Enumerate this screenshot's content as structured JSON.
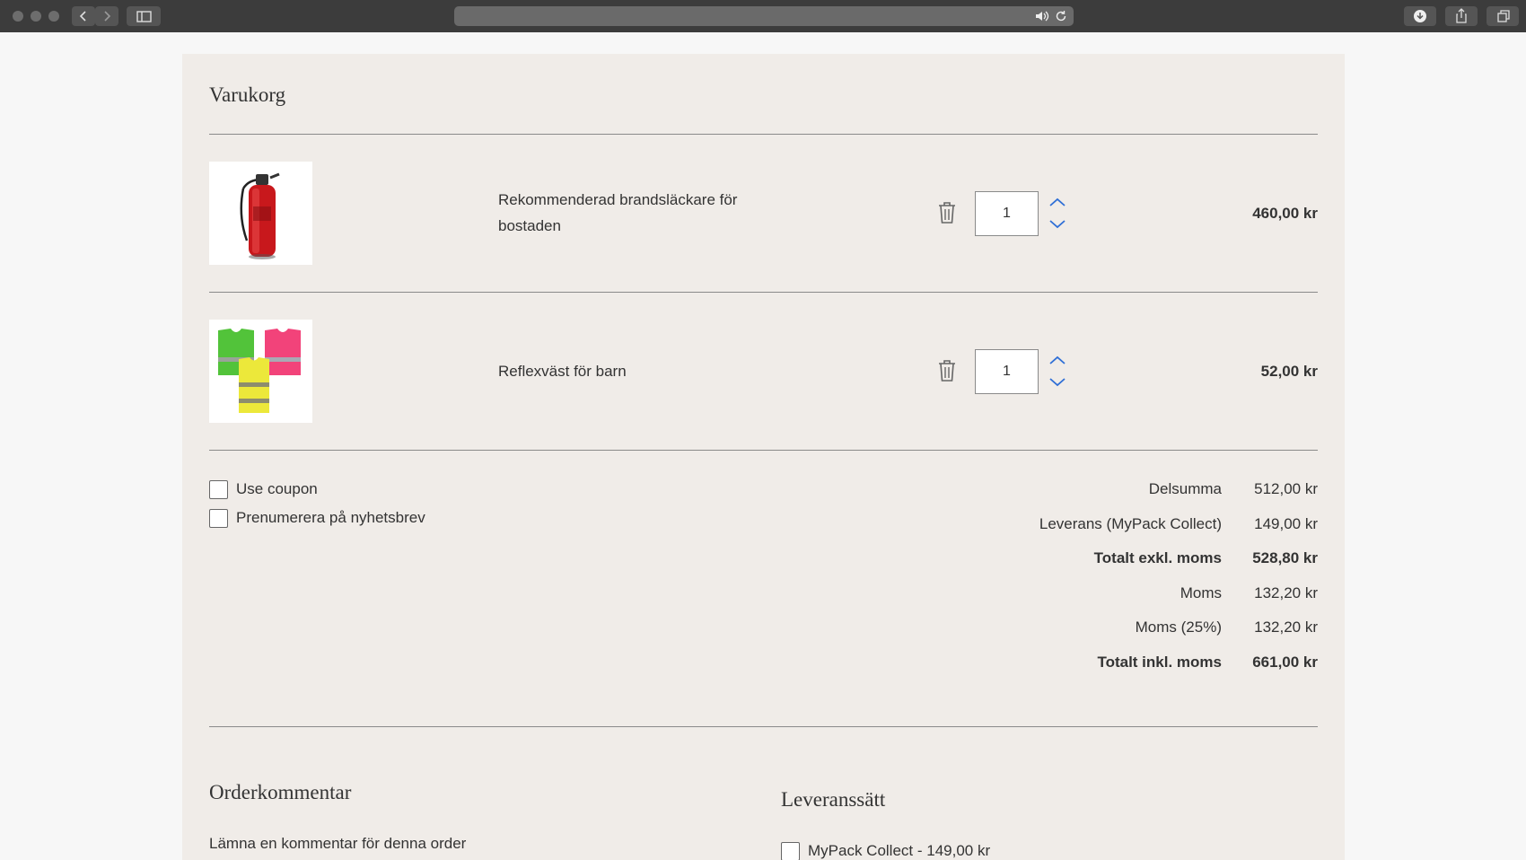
{
  "cart": {
    "title": "Varukorg",
    "items": [
      {
        "name": "Rekommenderad brandsläckare för bostaden",
        "quantity": "1",
        "price": "460,00 kr",
        "image": "fire-extinguisher"
      },
      {
        "name": "Reflexväst för barn",
        "quantity": "1",
        "price": "52,00 kr",
        "image": "reflective-vests"
      }
    ],
    "options": [
      {
        "label": "Use coupon",
        "checked": false
      },
      {
        "label": "Prenumerera på nyhetsbrev",
        "checked": false
      }
    ],
    "summary": [
      {
        "label": "Delsumma",
        "value": "512,00 kr",
        "bold": false
      },
      {
        "label": "Leverans (MyPack Collect)",
        "value": "149,00 kr",
        "bold": false
      },
      {
        "label": "Totalt exkl. moms",
        "value": "528,80 kr",
        "bold": true
      },
      {
        "label": "Moms",
        "value": "132,20 kr",
        "bold": false
      },
      {
        "label": "Moms (25%)",
        "value": "132,20 kr",
        "bold": false
      },
      {
        "label": "Totalt inkl. moms",
        "value": "661,00 kr",
        "bold": true
      }
    ]
  },
  "order_comment": {
    "title": "Orderkommentar",
    "prompt": "Lämna en kommentar för denna order"
  },
  "shipping": {
    "title": "Leveranssätt",
    "option_label": "MyPack Collect - 149,00 kr",
    "checked": false
  },
  "colors": {
    "chrome": "#3c3c3c",
    "panel": "#f0ece8",
    "accent_blue": "#2f6fd6"
  }
}
